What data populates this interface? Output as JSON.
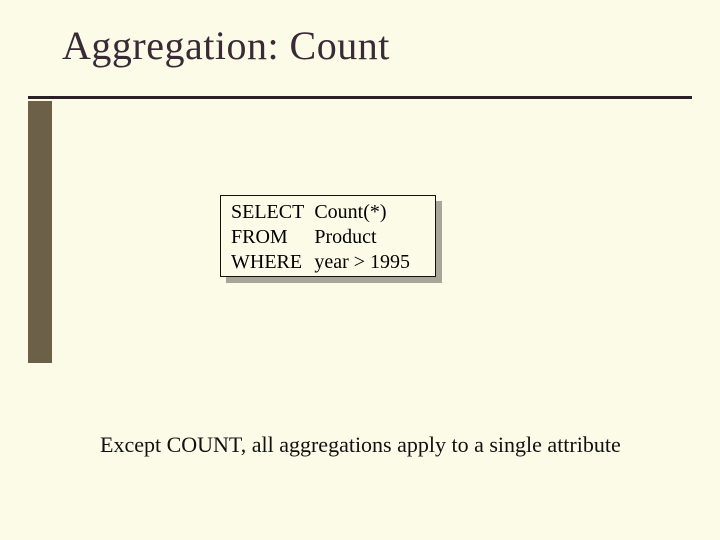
{
  "title": "Aggregation: Count",
  "code": {
    "rows": [
      {
        "keyword": "SELECT",
        "rest": "Count(*)"
      },
      {
        "keyword": "FROM",
        "rest": "Product"
      },
      {
        "keyword": "WHERE",
        "rest": "year > 1995"
      }
    ]
  },
  "note": "Except COUNT, all aggregations apply to a single attribute"
}
